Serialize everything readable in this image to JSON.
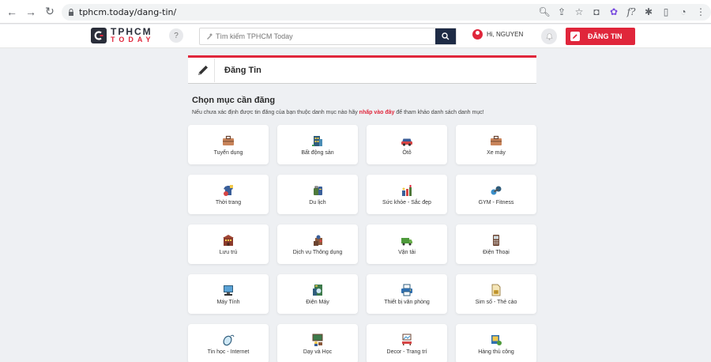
{
  "browser": {
    "url": "tphcm.today/dang-tin/"
  },
  "header": {
    "logo_line1": "TPHCM",
    "logo_line2": "TODAY",
    "help_label": "?",
    "search_placeholder": "Tìm kiếm TPHCM Today",
    "user_name": "Hi, NGUYEN",
    "post_button": "ĐĂNG TIN"
  },
  "panel": {
    "title": "Đăng Tin",
    "section_title": "Chọn mục cần đăng",
    "sub_before": "Nếu chưa xác định được tin đăng của bạn thuộc danh mục nào hãy",
    "sub_link": "nhấp vào đây",
    "sub_after": "để tham khảo danh sách danh mục!"
  },
  "categories": [
    {
      "label": "Tuyển dụng",
      "icon": "briefcase-icon"
    },
    {
      "label": "Bất động sản",
      "icon": "building-icon"
    },
    {
      "label": "Ôtô",
      "icon": "car-icon"
    },
    {
      "label": "Xe máy",
      "icon": "motorbike-icon"
    },
    {
      "label": "Thời trang",
      "icon": "fashion-icon"
    },
    {
      "label": "Du lịch",
      "icon": "luggage-icon"
    },
    {
      "label": "Sức khỏe - Sắc đẹp",
      "icon": "beauty-icon"
    },
    {
      "label": "GYM - Fitness",
      "icon": "dumbbell-icon"
    },
    {
      "label": "Lưu trú",
      "icon": "hotel-icon"
    },
    {
      "label": "Dịch vụ Thông dụng",
      "icon": "service-icon"
    },
    {
      "label": "Vận tải",
      "icon": "truck-icon"
    },
    {
      "label": "Điện Thoại",
      "icon": "phone-icon"
    },
    {
      "label": "Máy Tính",
      "icon": "computer-icon"
    },
    {
      "label": "Điện Máy",
      "icon": "washing-machine-icon"
    },
    {
      "label": "Thiết bị văn phòng",
      "icon": "printer-icon"
    },
    {
      "label": "Sim số - Thẻ cào",
      "icon": "sim-card-icon"
    },
    {
      "label": "Tin học - Internet",
      "icon": "mouse-icon"
    },
    {
      "label": "Dạy và Học",
      "icon": "blackboard-icon"
    },
    {
      "label": "Decor - Trang trí",
      "icon": "decor-icon"
    },
    {
      "label": "Hàng thủ công",
      "icon": "handicraft-icon"
    }
  ],
  "colors": {
    "brand_red": "#e0263b",
    "navy": "#1e2b45"
  }
}
